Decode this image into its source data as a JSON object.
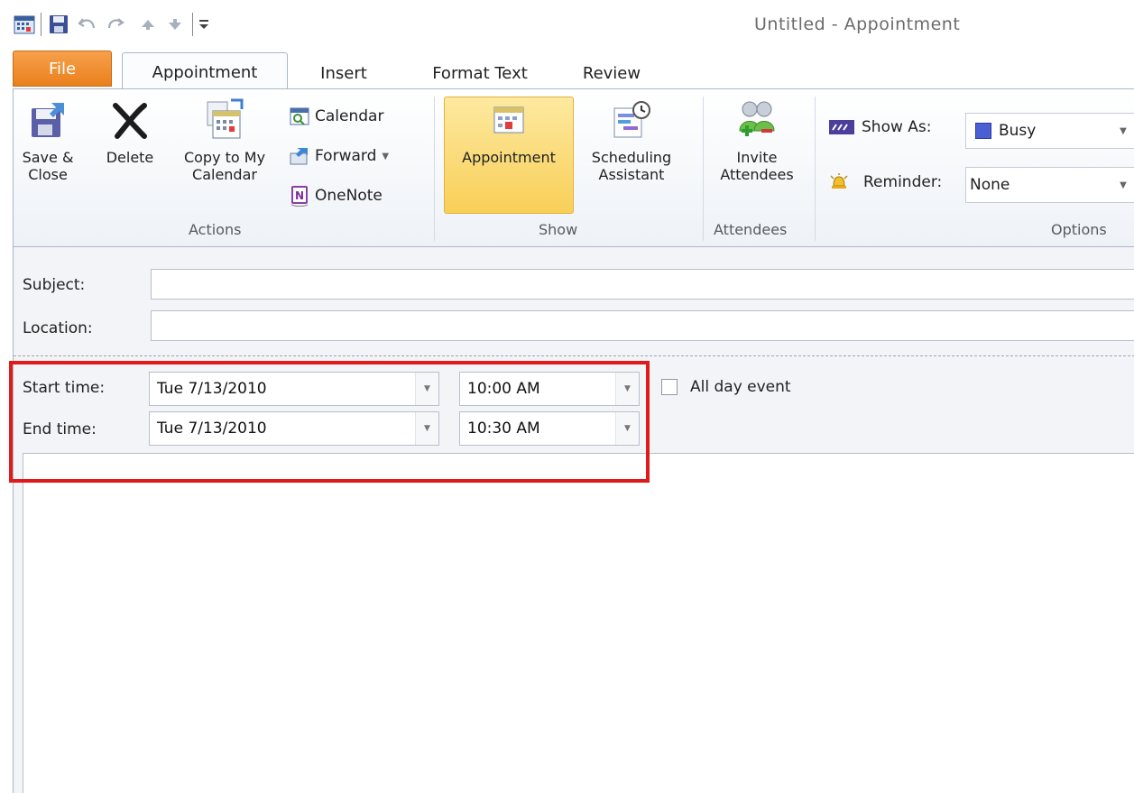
{
  "window": {
    "title": "Untitled - Appointment"
  },
  "quick_access": {
    "icons": [
      "calendar-app-icon",
      "save-icon",
      "undo-icon",
      "redo-icon",
      "previous-item-icon",
      "next-item-icon",
      "customize-qat-icon"
    ]
  },
  "tabs": [
    {
      "label": "File"
    },
    {
      "label": "Appointment"
    },
    {
      "label": "Insert"
    },
    {
      "label": "Format Text"
    },
    {
      "label": "Review"
    }
  ],
  "ribbon": {
    "actions": {
      "label": "Actions",
      "save_close": "Save &\nClose",
      "delete": "Delete",
      "copy_to_calendar": "Copy to My\nCalendar",
      "calendar": "Calendar",
      "forward": "Forward",
      "onenote": "OneNote"
    },
    "show": {
      "label": "Show",
      "appointment": "Appointment",
      "scheduling": "Scheduling\nAssistant"
    },
    "attendees": {
      "label": "Attendees",
      "invite": "Invite\nAttendees"
    },
    "options": {
      "label": "Options",
      "show_as_label": "Show As:",
      "show_as_value": "Busy",
      "reminder_label": "Reminder:",
      "reminder_value": "None"
    }
  },
  "form": {
    "subject_label": "Subject:",
    "subject_value": "",
    "location_label": "Location:",
    "location_value": "",
    "start_label": "Start time:",
    "start_date": "Tue 7/13/2010",
    "start_time": "10:00 AM",
    "all_day_label": "All day event",
    "all_day_checked": false,
    "end_label": "End time:",
    "end_date": "Tue 7/13/2010",
    "end_time": "10:30 AM"
  },
  "colors": {
    "file_tab": "#e9801d",
    "active_button": "#f8cf58",
    "highlight_box": "#e01a1a",
    "busy_swatch": "#4a5fd6"
  }
}
